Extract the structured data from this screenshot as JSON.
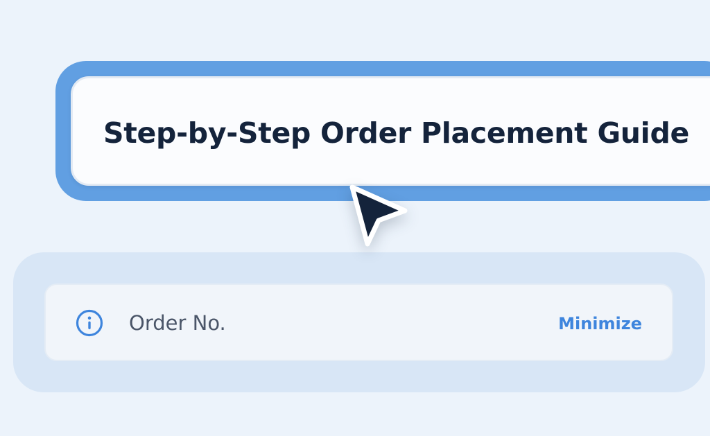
{
  "header": {
    "title": "Step-by-Step Order Placement Guide"
  },
  "order_bar": {
    "label": "Order No.",
    "minimize_label": "Minimize",
    "icon": "info-icon"
  },
  "cursor": {
    "icon": "mouse-pointer-icon"
  },
  "colors": {
    "background": "#ecf3fb",
    "focus_ring": "#619fe2",
    "title_text": "#14233b",
    "accent": "#3e85dd",
    "panel": "#d8e6f6",
    "label_text": "#4a5568"
  }
}
